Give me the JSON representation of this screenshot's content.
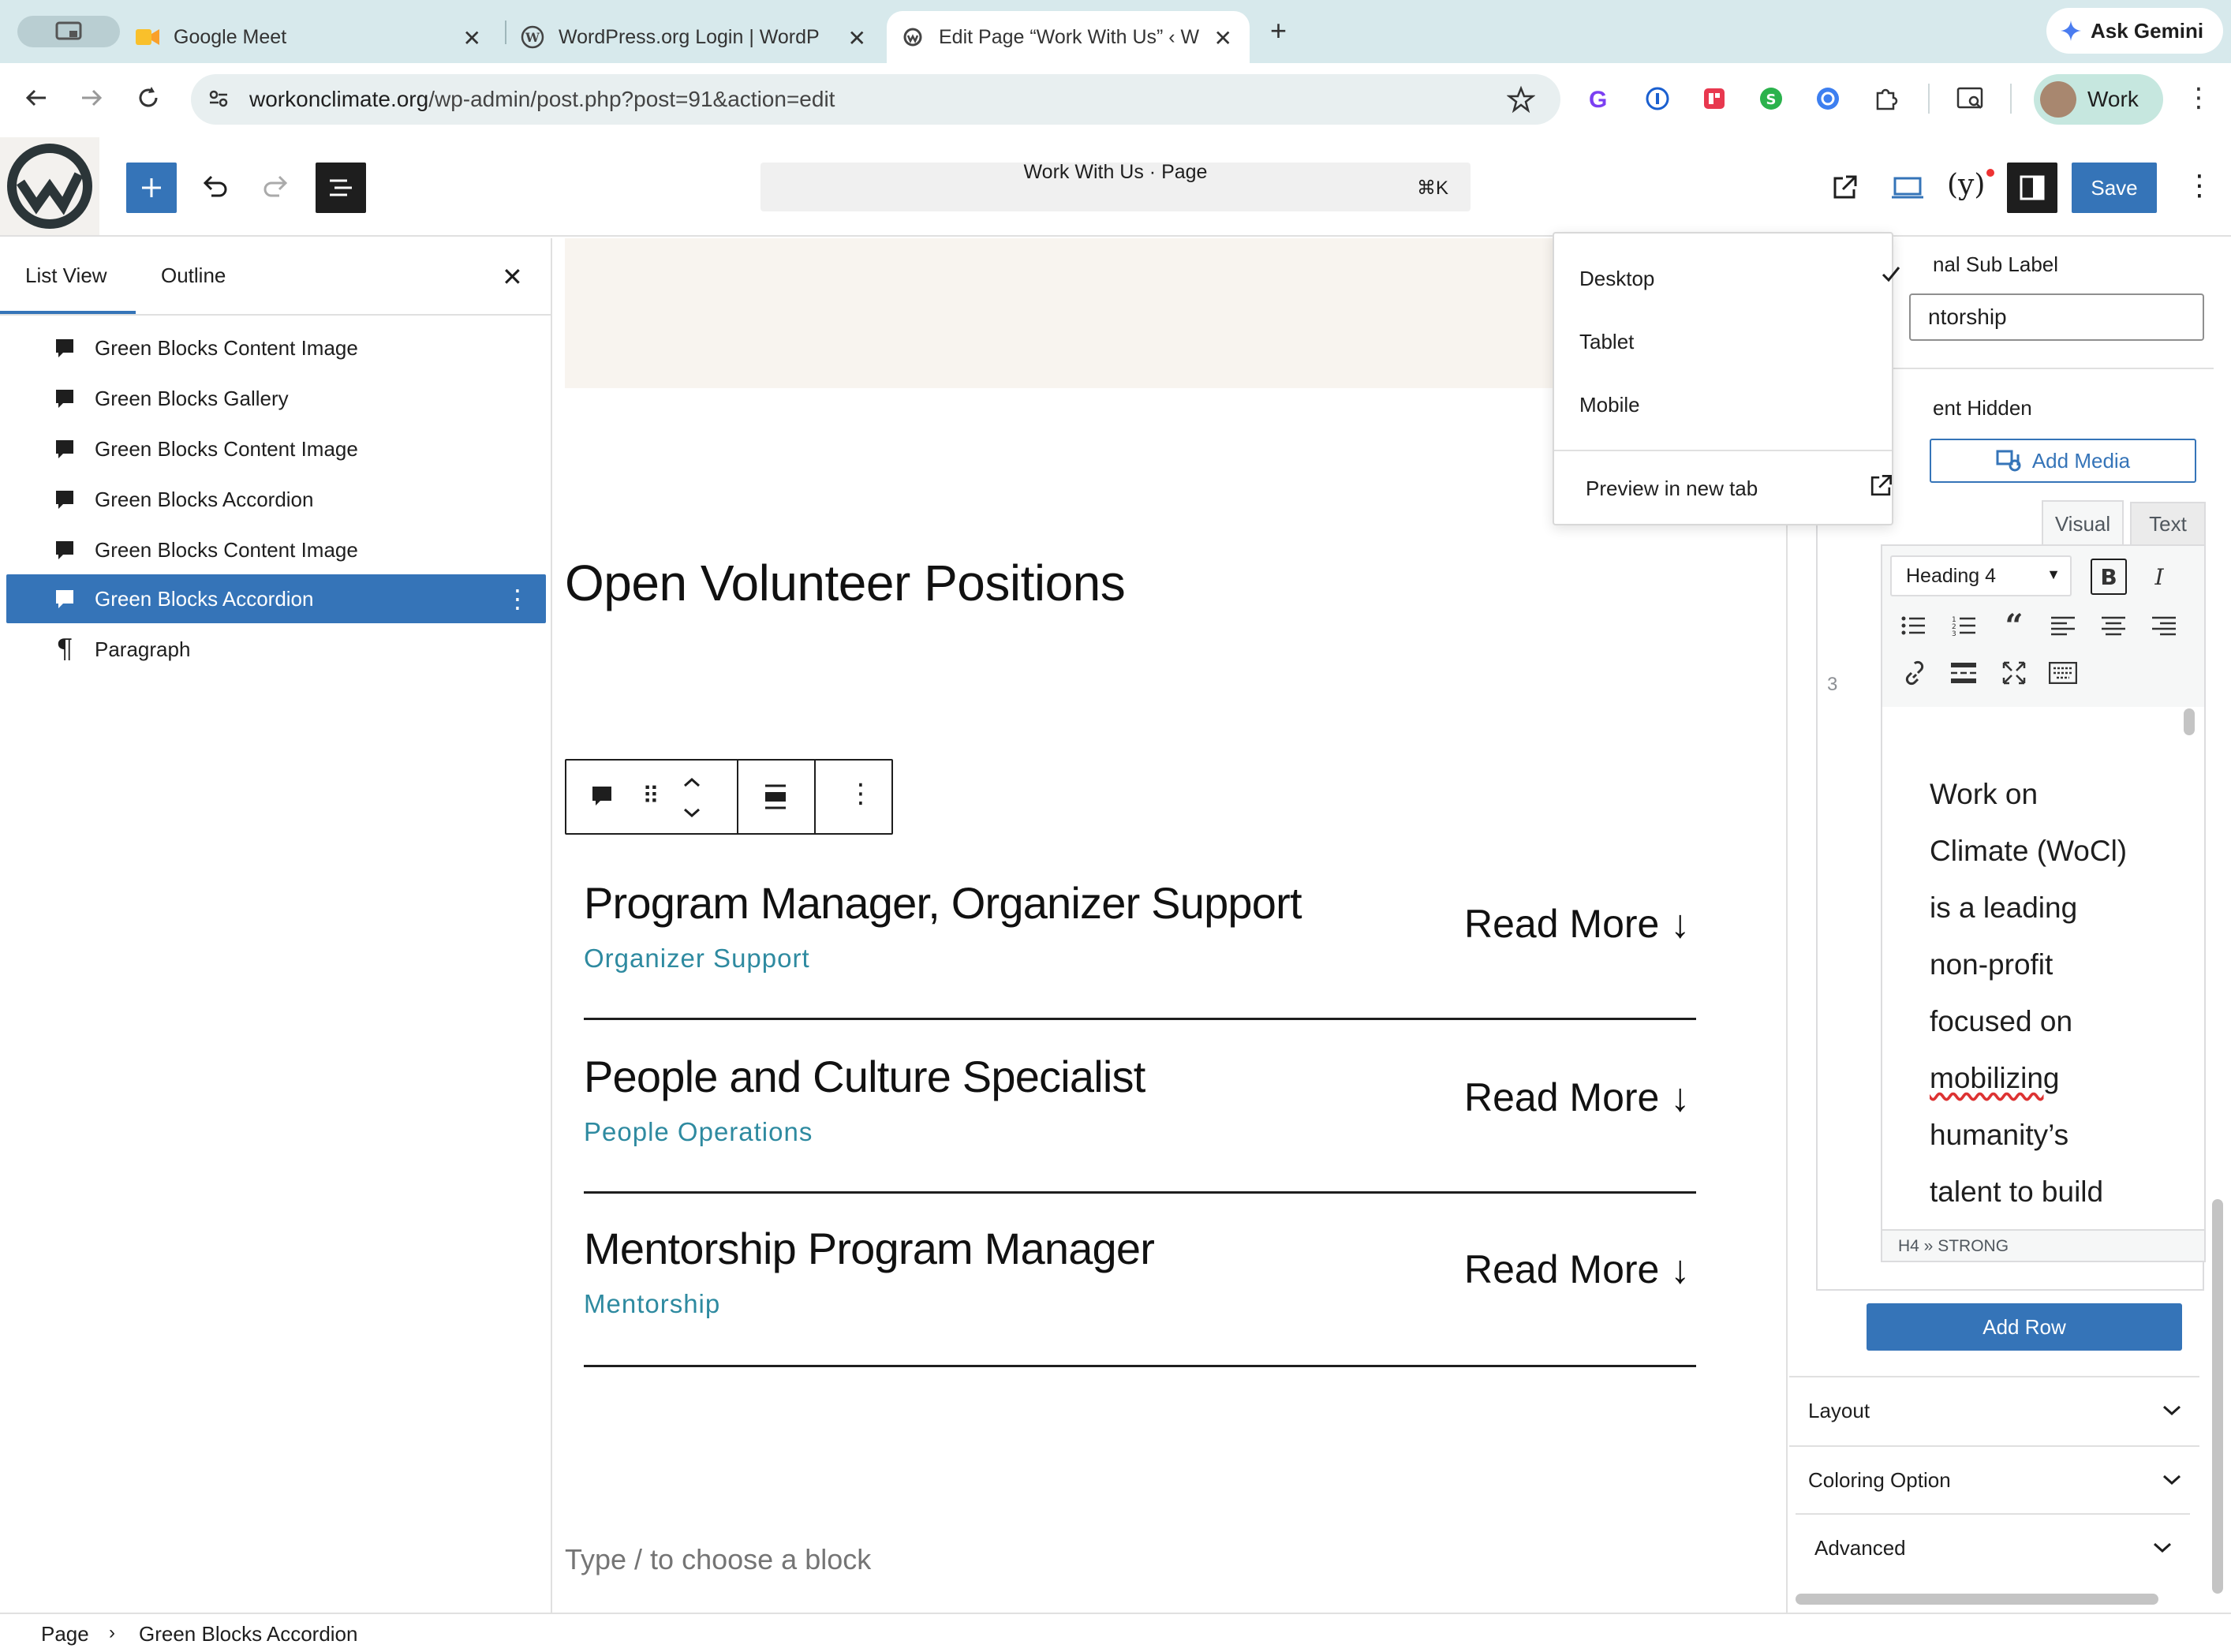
{
  "browser": {
    "tabs": [
      {
        "label": "Google Meet"
      },
      {
        "label": "WordPress.org Login | WordP"
      },
      {
        "label": "Edit Page “Work With Us” ‹ W"
      }
    ],
    "ask_gemini": "Ask Gemini",
    "url_host": "workonclimate.org",
    "url_path": "/wp-admin/post.php?post=91&action=edit",
    "profile_label": "Work"
  },
  "wp": {
    "doc_title": "Work With Us · Page",
    "doc_kbd": "⌘K",
    "save_label": "Save"
  },
  "listview": {
    "tabs": [
      "List View",
      "Outline"
    ],
    "items": [
      {
        "label": "Green Blocks Content Image"
      },
      {
        "label": "Green Blocks Gallery"
      },
      {
        "label": "Green Blocks Content Image"
      },
      {
        "label": "Green Blocks Accordion"
      },
      {
        "label": "Green Blocks Content Image"
      },
      {
        "label": "Green Blocks Accordion"
      },
      {
        "label": "Paragraph"
      }
    ]
  },
  "canvas": {
    "heading": "Open Volunteer Positions",
    "accordion": [
      {
        "title": "Program Manager, Organizer Support",
        "subtitle": "Organizer Support",
        "more": "Read More ↓"
      },
      {
        "title": "People and Culture Specialist",
        "subtitle": "People Operations",
        "more": "Read More ↓"
      },
      {
        "title": "Mentorship Program Manager",
        "subtitle": "Mentorship",
        "more": "Read More ↓"
      }
    ],
    "placeholder": "Type / to choose a block"
  },
  "preview_menu": {
    "items": [
      "Desktop",
      "Tablet",
      "Mobile"
    ],
    "checked": "Desktop",
    "preview_new_tab": "Preview in new tab"
  },
  "sidebar": {
    "sub_label_heading": "nal Sub Label",
    "sub_label_value": "ntorship",
    "hidden_heading": "ent Hidden",
    "add_media": "Add Media",
    "editor_tabs": [
      "Visual",
      "Text"
    ],
    "format_select": "Heading 4",
    "row_number": "3",
    "editor_lines": [
      "Work on",
      "Climate (WoCl)",
      "is a leading",
      "non-profit",
      "focused on",
      "mobilizing",
      "humanity’s",
      "talent to build"
    ],
    "editor_path": "H4 » STRONG",
    "add_row": "Add Row",
    "sections": [
      "Layout",
      "Coloring Option",
      "Advanced"
    ]
  },
  "breadcrumb": [
    "Page",
    "Green Blocks Accordion"
  ]
}
